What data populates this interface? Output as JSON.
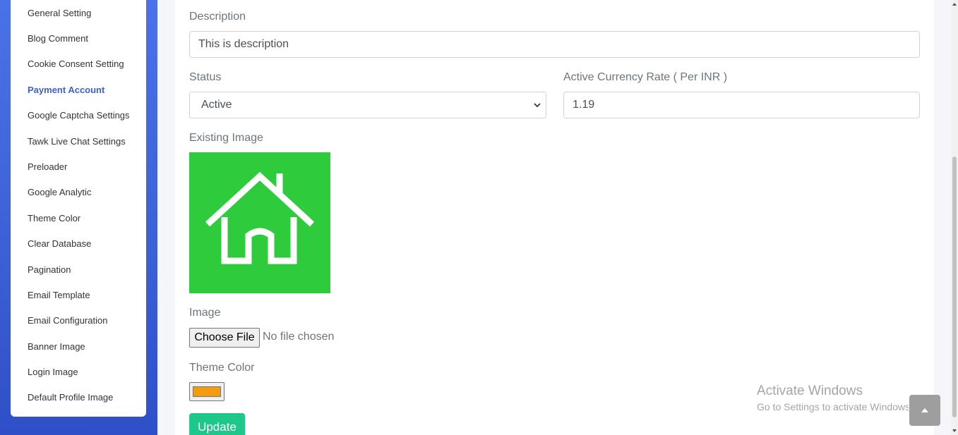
{
  "sidebar": {
    "items": [
      {
        "label": "General Setting"
      },
      {
        "label": "Blog Comment"
      },
      {
        "label": "Cookie Consent Setting"
      },
      {
        "label": "Payment Account",
        "active": true
      },
      {
        "label": "Google Captcha Settings"
      },
      {
        "label": "Tawk Live Chat Settings"
      },
      {
        "label": "Preloader"
      },
      {
        "label": "Google Analytic"
      },
      {
        "label": "Theme Color"
      },
      {
        "label": "Clear Database"
      },
      {
        "label": "Pagination"
      },
      {
        "label": "Email Template"
      },
      {
        "label": "Email Configuration"
      },
      {
        "label": "Banner Image"
      },
      {
        "label": "Login Image"
      },
      {
        "label": "Default Profile Image"
      }
    ]
  },
  "form": {
    "description_label": "Description",
    "description_value": "This is description",
    "status_label": "Status",
    "status_value": "Active",
    "rate_label": "Active Currency Rate ( Per INR )",
    "rate_value": "1.19",
    "existing_image_label": "Existing Image",
    "existing_image_icon": "house-icon",
    "image_label": "Image",
    "choose_file_label": "Choose File",
    "no_file_text": "No file chosen",
    "theme_color_label": "Theme Color",
    "theme_color_value": "#f39c12",
    "update_label": "Update"
  },
  "watermark": {
    "title": "Activate Windows",
    "subtitle": "Go to Settings to activate Windows."
  },
  "colors": {
    "accent": "#3b5fd6",
    "update_button": "#1ec78a",
    "image_bg": "#2ecc3c"
  }
}
